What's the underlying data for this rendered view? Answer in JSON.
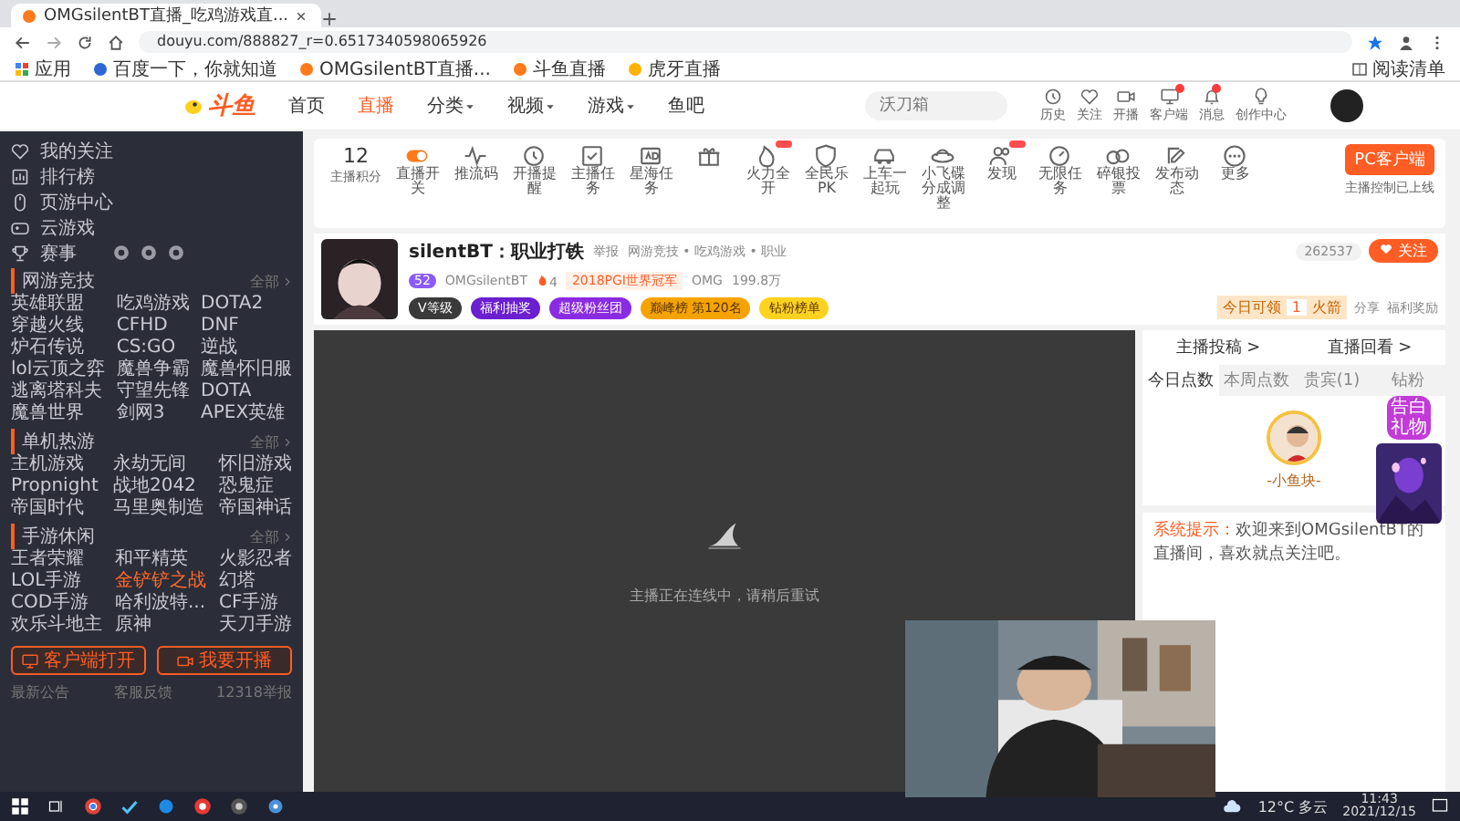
{
  "browser": {
    "tab_title": "OMGsilentBT直播_吃鸡游戏直...",
    "url": "douyu.com/888827_r=0.6517340598065926",
    "bookmarks": [
      "应用",
      "百度一下，你就知道",
      "OMGsilentBT直播...",
      "斗鱼直播",
      "虎牙直播"
    ],
    "reading_list": "阅读清单"
  },
  "header": {
    "logo": "斗鱼",
    "nav": [
      {
        "label": "首页",
        "selected": false,
        "dropdown": false
      },
      {
        "label": "直播",
        "selected": true,
        "dropdown": false
      },
      {
        "label": "分类",
        "selected": false,
        "dropdown": true
      },
      {
        "label": "视频",
        "selected": false,
        "dropdown": true
      },
      {
        "label": "游戏",
        "selected": false,
        "dropdown": true
      },
      {
        "label": "鱼吧",
        "selected": false,
        "dropdown": false
      }
    ],
    "search": {
      "placeholder": "沃刀箱"
    },
    "actions": [
      {
        "label": "历史",
        "kind": "clock",
        "badge": false
      },
      {
        "label": "关注",
        "kind": "heart",
        "badge": false
      },
      {
        "label": "开播",
        "kind": "camera",
        "badge": false
      },
      {
        "label": "客户端",
        "kind": "monitor",
        "badge": true
      },
      {
        "label": "消息",
        "kind": "bell",
        "badge": true
      },
      {
        "label": "创作中心",
        "kind": "bulb",
        "badge": false
      }
    ]
  },
  "toolbar": {
    "score": "12",
    "score_label": "主播积分",
    "items": [
      {
        "label": "直播开关",
        "kind": "toggle",
        "new": false
      },
      {
        "label": "推流码",
        "kind": "wave",
        "new": false
      },
      {
        "label": "开播提醒",
        "kind": "clock",
        "new": false
      },
      {
        "label": "主播任务",
        "kind": "check",
        "new": false
      },
      {
        "label": "星海任务",
        "kind": "ad",
        "new": false
      },
      {
        "kind": "gift",
        "new": false
      },
      {
        "label": "火力全开",
        "kind": "fire",
        "new": true
      },
      {
        "label": "全民乐PK",
        "kind": "shield",
        "new": false
      },
      {
        "label": "上车一起玩",
        "kind": "car",
        "new": false
      },
      {
        "label": "小飞碟分成调整",
        "kind": "ufo",
        "new": false
      },
      {
        "label": "发现",
        "kind": "people",
        "new": true
      },
      {
        "label": "无限任务",
        "kind": "gauge",
        "new": false
      },
      {
        "label": "碎银投票",
        "kind": "vote",
        "new": false
      },
      {
        "label": "发布动态",
        "kind": "edit",
        "new": false
      },
      {
        "label": "更多",
        "kind": "more",
        "new": false
      }
    ],
    "pc_button": "PC客户端",
    "pc_note": "主播控制已上线"
  },
  "sidebar": {
    "nav": [
      {
        "label": "我的关注",
        "kind": "heart"
      },
      {
        "label": "排行榜",
        "kind": "rank"
      },
      {
        "label": "页游中心",
        "kind": "mouse"
      },
      {
        "label": "云游戏",
        "kind": "gamepad"
      },
      {
        "label": "赛事",
        "kind": "trophy"
      }
    ],
    "sections": [
      {
        "title": "网游竞技",
        "more": "全部",
        "games": [
          {
            "label": "英雄联盟",
            "highlighted": false
          },
          {
            "label": "吃鸡游戏",
            "highlighted": false
          },
          {
            "label": "DOTA2",
            "highlighted": false
          },
          {
            "label": "穿越火线",
            "highlighted": false
          },
          {
            "label": "CFHD",
            "highlighted": false
          },
          {
            "label": "DNF",
            "highlighted": false
          },
          {
            "label": "炉石传说",
            "highlighted": false
          },
          {
            "label": "CS:GO",
            "highlighted": false
          },
          {
            "label": "逆战",
            "highlighted": false
          },
          {
            "label": "lol云顶之弈",
            "highlighted": false
          },
          {
            "label": "魔兽争霸",
            "highlighted": false
          },
          {
            "label": "魔兽怀旧服",
            "highlighted": false
          },
          {
            "label": "逃离塔科夫",
            "highlighted": false
          },
          {
            "label": "守望先锋",
            "highlighted": false
          },
          {
            "label": "DOTA",
            "highlighted": false
          },
          {
            "label": "魔兽世界",
            "highlighted": false
          },
          {
            "label": "剑网3",
            "highlighted": false
          },
          {
            "label": "APEX英雄",
            "highlighted": false
          }
        ]
      },
      {
        "title": "单机热游",
        "more": "全部",
        "games": [
          {
            "label": "主机游戏",
            "highlighted": false
          },
          {
            "label": "永劫无间",
            "highlighted": false
          },
          {
            "label": "怀旧游戏",
            "highlighted": false
          },
          {
            "label": "Propnight",
            "highlighted": false
          },
          {
            "label": "战地2042",
            "highlighted": false
          },
          {
            "label": "恐鬼症",
            "highlighted": false
          },
          {
            "label": "帝国时代",
            "highlighted": false
          },
          {
            "label": "马里奥制造",
            "highlighted": false
          },
          {
            "label": "帝国神话",
            "highlighted": false
          }
        ]
      },
      {
        "title": "手游休闲",
        "more": "全部",
        "games": [
          {
            "label": "王者荣耀",
            "highlighted": false
          },
          {
            "label": "和平精英",
            "highlighted": false
          },
          {
            "label": "火影忍者",
            "highlighted": false
          },
          {
            "label": "LOL手游",
            "highlighted": false
          },
          {
            "label": "金铲铲之战",
            "highlighted": true
          },
          {
            "label": "幻塔",
            "highlighted": false
          },
          {
            "label": "COD手游",
            "highlighted": false
          },
          {
            "label": "哈利波特...",
            "highlighted": false
          },
          {
            "label": "CF手游",
            "highlighted": false
          },
          {
            "label": "欢乐斗地主",
            "highlighted": false
          },
          {
            "label": "原神",
            "highlighted": false
          },
          {
            "label": "天刀手游",
            "highlighted": false
          }
        ]
      }
    ],
    "buttons": [
      {
        "label": "客户端打开",
        "kind": "monitor"
      },
      {
        "label": "我要开播",
        "kind": "camera"
      }
    ],
    "footer": [
      "最新公告",
      "客服反馈",
      "12318举报"
    ]
  },
  "channel": {
    "title": "silentBT：职业打铁",
    "report": "举报",
    "category": "网游竞技 • 吃鸡游戏 • 职业",
    "level": "52",
    "anchor": "OMGsilentBT",
    "hot": "4",
    "honor": "2018PGI世界冠军",
    "team": "OMG",
    "followers": "199.8万",
    "chips": [
      {
        "label": "V等级",
        "color": "#3a3a3a"
      },
      {
        "label": "福利抽奖",
        "color": "#6a1fd0"
      },
      {
        "label": "超级粉丝团",
        "color": "#8a2be2"
      },
      {
        "label": "巅峰榜 第120名",
        "color": "#f5a300"
      },
      {
        "label": "钻粉榜单",
        "color": "#ffd21f"
      }
    ],
    "online": "262537",
    "follow": "关注",
    "reward": {
      "prefix": "今日可领",
      "count": "1",
      "unit": "火箭"
    },
    "links": [
      "分享",
      "福利奖励"
    ]
  },
  "video": {
    "message": "主播正在连线中，请稍后重试"
  },
  "panel": {
    "links": [
      "主播投稿 >",
      "直播回看 >"
    ],
    "tabs": [
      {
        "label": "今日点数",
        "selected": true
      },
      {
        "label": "本周点数",
        "selected": false
      },
      {
        "label": "贵宾(1)",
        "selected": false
      },
      {
        "label": "钻粉",
        "selected": false
      }
    ],
    "top_user": "-小鱼块-",
    "system": {
      "label": "系统提示：",
      "text": "欢迎来到OMGsilentBT的直播间，喜欢就点关注吧。"
    },
    "promo": "告白礼物"
  },
  "taskbar": {
    "weather": "12°C 多云",
    "time": "11:43",
    "date": "2021/12/15"
  }
}
